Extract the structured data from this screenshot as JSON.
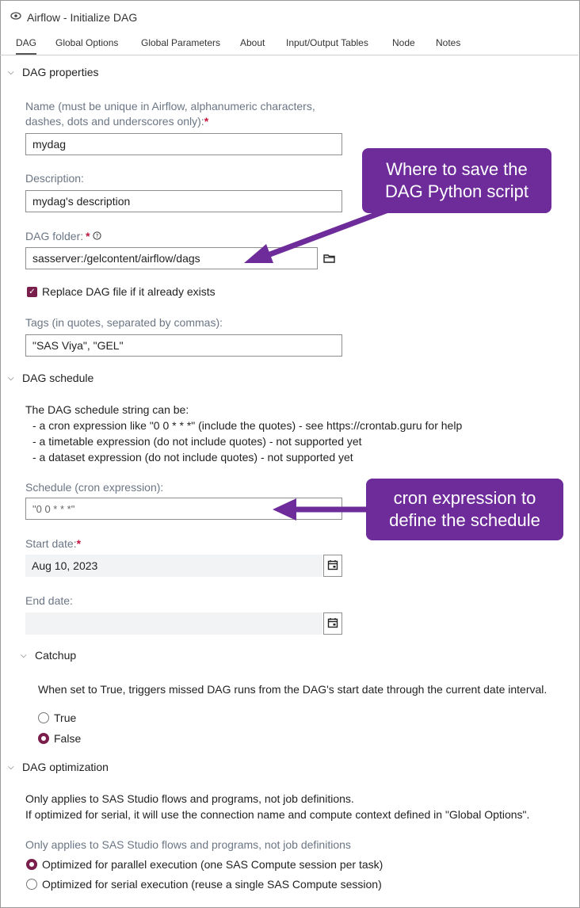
{
  "window": {
    "title": "Airflow - Initialize DAG"
  },
  "tabs": [
    "DAG",
    "Global Options",
    "Global Parameters",
    "About",
    "Input/Output Tables",
    "Node",
    "Notes"
  ],
  "dag_properties": {
    "header": "DAG properties",
    "name_label_line1": "Name (must be unique in Airflow, alphanumeric characters,",
    "name_label_line2": "dashes, dots and underscores only):",
    "name_value": "mydag",
    "description_label": "Description:",
    "description_value": "mydag's description",
    "folder_label": "DAG folder:",
    "folder_value": "sasserver:/gelcontent/airflow/dags",
    "replace_label": "Replace DAG file if it already exists",
    "tags_label": "Tags (in quotes, separated by commas):",
    "tags_value": "\"SAS Viya\", \"GEL\""
  },
  "dag_schedule": {
    "header": "DAG schedule",
    "intro": "The DAG schedule string can be:",
    "bullet1": "- a cron expression like \"0 0 * * *\" (include the quotes) - see https://crontab.guru for help",
    "bullet2": "- a timetable expression (do not include quotes) - not supported yet",
    "bullet3": "- a dataset expression (do not include quotes) - not supported yet",
    "schedule_label": "Schedule (cron expression):",
    "schedule_placeholder": "\"0 0 * * *\"",
    "start_label": "Start date:",
    "start_value": "Aug 10, 2023",
    "end_label": "End date:",
    "end_value": ""
  },
  "catchup": {
    "header": "Catchup",
    "desc": "When set to True, triggers missed DAG runs from the DAG's start date through the current date interval.",
    "opt_true": "True",
    "opt_false": "False",
    "selected": "False"
  },
  "dag_optimization": {
    "header": "DAG optimization",
    "text1": "Only applies to SAS Studio flows and programs, not job definitions.",
    "text2": "If optimized for serial, it will use the connection name and compute context defined in \"Global Options\".",
    "sub_label": "Only applies to SAS Studio flows and programs, not job definitions",
    "opt_parallel": "Optimized for parallel execution (one SAS Compute session per task)",
    "opt_serial": "Optimized for serial execution (reuse a single SAS Compute session)",
    "selected": "parallel"
  },
  "annotations": {
    "callout1_line1": "Where to save the",
    "callout1_line2": "DAG Python script",
    "callout2_line1": "cron expression to",
    "callout2_line2": "define the schedule",
    "color": "#6e2c9b"
  },
  "colors": {
    "accent": "#7a1f4b",
    "required": "#c0143c",
    "label": "#6b7685"
  },
  "icons": {
    "app": "eye-gear-icon",
    "help": "help-icon",
    "folder": "folder-icon",
    "calendar": "calendar-icon",
    "chevron": "chevron-down-icon"
  }
}
